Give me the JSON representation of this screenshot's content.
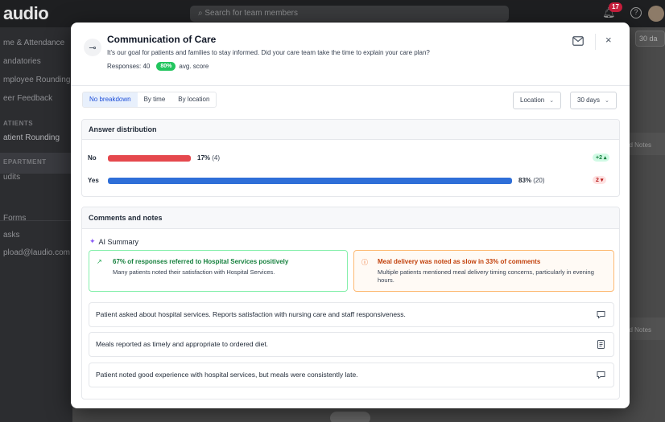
{
  "background": {
    "logo": "audio",
    "search_placeholder": "Search for team members",
    "notification_count": "17",
    "help": "?",
    "sidebar_items": [
      "me & Attendance",
      "andatories",
      "mployee Rounding",
      "eer Feedback",
      "atient Rounding",
      "udits",
      "Forms",
      "asks",
      "pload@laudio.com"
    ],
    "sidebar_sections": [
      "ATIENTS",
      "EPARTMENT"
    ],
    "right_button": "30 da",
    "right_notes_1": "ed Notes",
    "right_notes_2": "ed Notes",
    "bottom_text": "Rounds"
  },
  "modal": {
    "title": "Communication of Care",
    "subtitle": "It's our goal for patients and families to stay informed. Did your care team take the time to explain your care plan?",
    "responses_label": "Responses: 40",
    "score_value": "80%",
    "score_label": "avg. score",
    "close": "×"
  },
  "filters": {
    "tabs": [
      "No breakdown",
      "By time",
      "By location"
    ],
    "active_tab": "No breakdown",
    "location": "Location",
    "period": "30 days"
  },
  "distribution": {
    "heading": "Answer distribution",
    "rows": [
      {
        "label": "No",
        "pct_text": "17%",
        "count_text": "(4)",
        "fraction": 0.17,
        "color": "#e5484d",
        "delta": "+2 ▴",
        "delta_kind": "up"
      },
      {
        "label": "Yes",
        "pct_text": "83%",
        "count_text": "(20)",
        "fraction": 0.83,
        "color": "#2f6fd8",
        "delta": "2 ▾",
        "delta_kind": "down"
      }
    ]
  },
  "comments": {
    "heading": "Comments and notes",
    "ai_title": "AI Summary",
    "insight_positive": {
      "title": "67% of responses referred to Hospital Services positively",
      "body": "Many patients noted their satisfaction with Hospital Services."
    },
    "insight_warning": {
      "title": "Meal delivery was noted as slow in 33% of comments",
      "body": "Multiple patients mentioned meal delivery timing concerns, particularly in evening hours."
    },
    "notes": [
      {
        "text": "Patient asked about hospital services. Reports satisfaction with nursing care and staff responsiveness.",
        "icon": "chat-icon"
      },
      {
        "text": "Meals reported as timely and appropriate to ordered diet.",
        "icon": "document-icon"
      },
      {
        "text": "Patient noted good experience with hospital services, but meals were consistently late.",
        "icon": "chat-icon"
      }
    ]
  }
}
